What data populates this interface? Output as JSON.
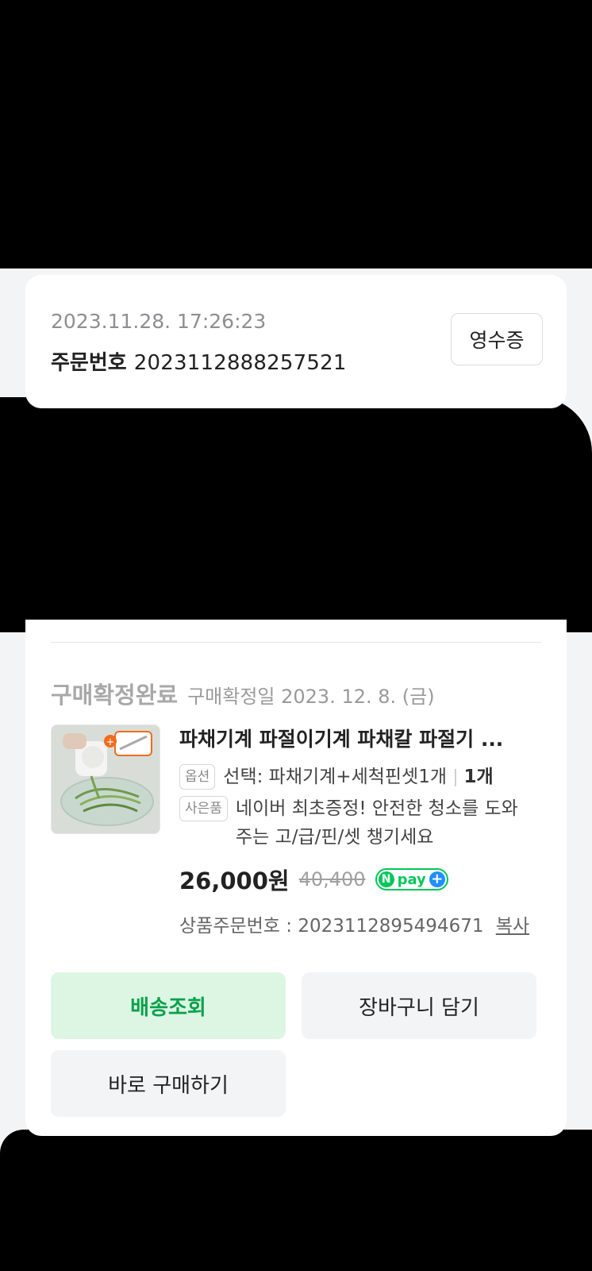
{
  "order": {
    "datetime": "2023.11.28. 17:26:23",
    "order_number_label": "주문번호",
    "order_number": "2023112888257521",
    "receipt_label": "영수증"
  },
  "product": {
    "status": "구매확정완료",
    "confirm_date": "구매확정일 2023. 12. 8. (금)",
    "name": "파채기계 파절이기계 파채칼 파절기 ...",
    "option_tag": "옵션",
    "option_text": "선택: 파채기계+세척핀셋1개",
    "quantity": "1개",
    "gift_tag": "사은품",
    "gift_text": "네이버 최초증정! 안전한 청소를 도와주는 고/급/핀/셋 챙기세요",
    "price": "26,000원",
    "original_price": "40,400",
    "npay_n": "N",
    "npay_text": "pay",
    "npay_plus": "+",
    "product_order_label": "상품주문번호 : 2023112895494671",
    "copy_label": "복사"
  },
  "buttons": {
    "track": "배송조회",
    "cart": "장바구니 담기",
    "buy_now": "바로 구매하기"
  },
  "colors": {
    "accent_green": "#03c75a",
    "track_bg": "#ddf6e4",
    "track_text": "#0aa14b",
    "page_bg": "#f3f4f6"
  }
}
